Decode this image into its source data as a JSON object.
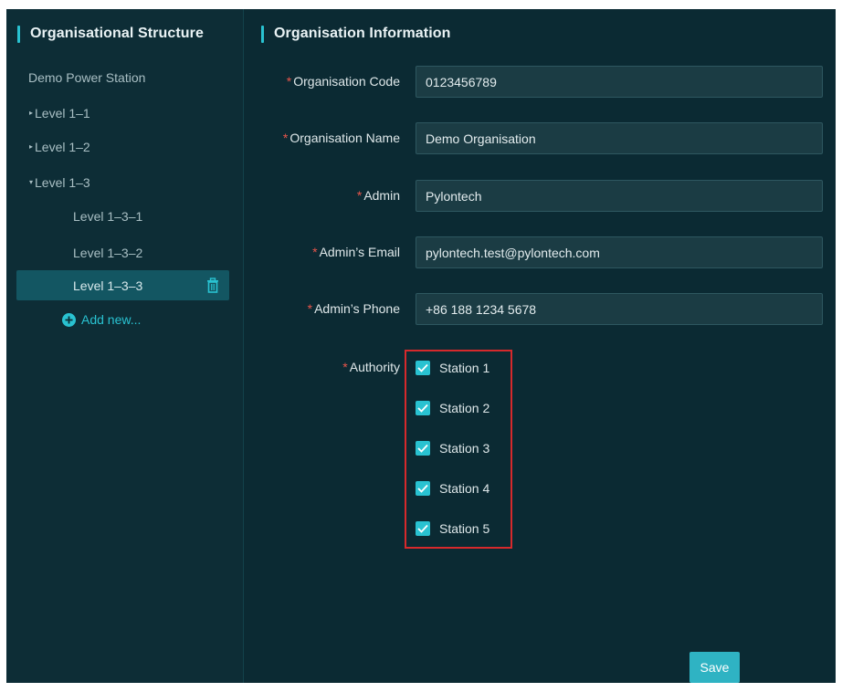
{
  "left": {
    "title": "Organisational Structure",
    "root": "Demo Power Station",
    "items": [
      {
        "label": "Level 1–1"
      },
      {
        "label": "Level 1–2"
      },
      {
        "label": "Level 1–3"
      }
    ],
    "children": [
      {
        "label": "Level 1–3–1"
      },
      {
        "label": "Level 1–3–2"
      },
      {
        "label": "Level 1–3–3"
      }
    ],
    "add_new": "Add new..."
  },
  "right": {
    "title": "Organisation Information",
    "required_mark": "*",
    "fields": {
      "code": {
        "label": "Organisation Code",
        "value": "0123456789"
      },
      "name": {
        "label": "Organisation Name",
        "value": "Demo Organisation"
      },
      "admin": {
        "label": "Admin",
        "value": "Pylontech"
      },
      "email": {
        "label": "Admin’s Email",
        "value": "pylontech.test@pylontech.com"
      },
      "phone": {
        "label": "Admin’s Phone",
        "value": "+86 188 1234 5678"
      }
    },
    "authority": {
      "label": "Authority",
      "stations": [
        {
          "label": "Station 1",
          "checked": true
        },
        {
          "label": "Station 2",
          "checked": true
        },
        {
          "label": "Station 3",
          "checked": true
        },
        {
          "label": "Station 4",
          "checked": true
        },
        {
          "label": "Station 5",
          "checked": true
        }
      ]
    },
    "save_label": "Save"
  },
  "colors": {
    "background": "#0b2a33",
    "accent": "#29c2d1",
    "selected": "#135662",
    "required": "#e8554b",
    "highlight_box": "#d6292c"
  },
  "icons": [
    "caret-right-icon",
    "caret-down-icon",
    "trash-icon",
    "plus-circle-icon",
    "checkmark-icon"
  ]
}
